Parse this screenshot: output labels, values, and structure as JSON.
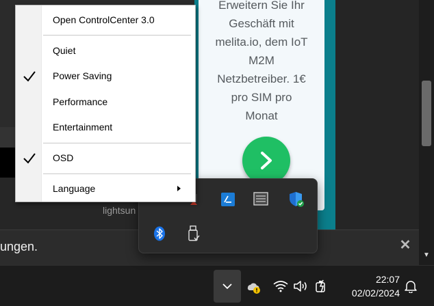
{
  "background": {
    "watermark_text": "lightsun",
    "ad": {
      "lines": [
        "Erweitern Sie Ihr",
        "Geschäft mit",
        "melita.io, dem IoT",
        "M2M",
        "Netzbetreiber. 1€",
        "pro SIM pro",
        "Monat"
      ],
      "go_icon": "chevron-right-icon",
      "colors": {
        "frame": "#0b7f8c",
        "button": "#1fbf64"
      }
    }
  },
  "notification": {
    "text": "ungen.",
    "close_icon": "close-icon"
  },
  "context_menu": {
    "items": [
      {
        "label": "Open ControlCenter 3.0",
        "checked": false
      },
      {
        "label": "Quiet",
        "checked": false
      },
      {
        "label": "Power Saving",
        "checked": true
      },
      {
        "label": "Performance",
        "checked": false
      },
      {
        "label": "Entertainment",
        "checked": false
      },
      {
        "label": "OSD",
        "checked": true
      },
      {
        "label": "Language",
        "checked": false,
        "has_submenu": true
      }
    ]
  },
  "tray_flyout": {
    "icons": [
      "app-tray-icon",
      "network-tray-icon",
      "intel-graphics-icon",
      "monitor-app-icon",
      "windows-security-icon",
      "bluetooth-icon",
      "usb-eject-icon"
    ]
  },
  "taskbar": {
    "chevron_icon": "chevron-down-icon",
    "tray_icons": [
      "onedrive-warning-icon",
      "wifi-icon",
      "volume-icon",
      "battery-charging-icon"
    ],
    "time": "22:07",
    "date": "02/02/2024",
    "notifications_icon": "bell-icon"
  }
}
